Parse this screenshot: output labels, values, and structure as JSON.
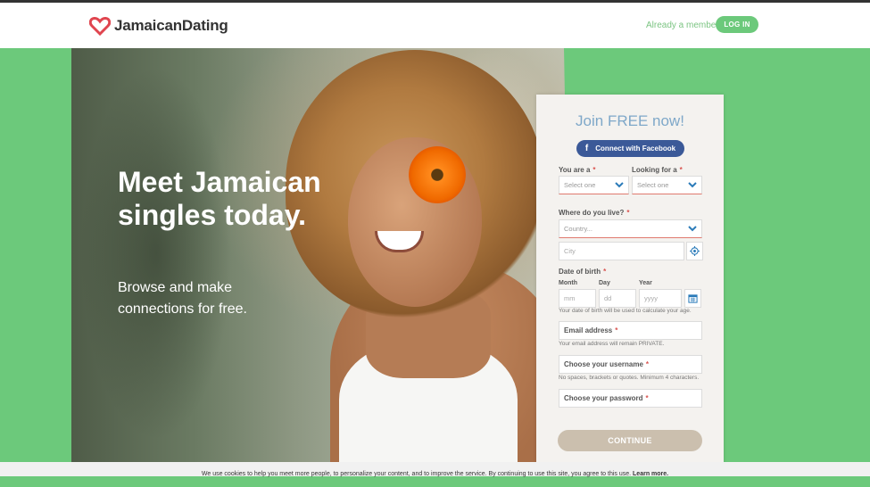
{
  "header": {
    "brand": "JamaicanDating",
    "member_prompt": "Already a member?",
    "login_label": "LOG IN"
  },
  "hero": {
    "headline": "Meet Jamaican singles today.",
    "subtext": "Browse and make connections for free."
  },
  "form": {
    "title": "Join FREE now!",
    "facebook_label": "Connect with Facebook",
    "you_are_label": "You are a",
    "you_are_placeholder": "Select one",
    "looking_for_label": "Looking for a",
    "looking_for_placeholder": "Select one",
    "location_label": "Where do you live?",
    "country_placeholder": "Country...",
    "city_placeholder": "City",
    "dob_label": "Date of birth",
    "month_label": "Month",
    "day_label": "Day",
    "year_label": "Year",
    "month_placeholder": "mm",
    "day_placeholder": "dd",
    "year_placeholder": "yyyy",
    "dob_hint": "Your date of birth will be used to calculate your age.",
    "email_label": "Email address",
    "email_hint": "Your email address will remain PRIVATE.",
    "username_label": "Choose your username",
    "username_hint": "No spaces, brackets or quotes. Minimum 4 characters.",
    "password_label": "Choose your password",
    "required_mark": "*",
    "continue_label": "CONTINUE"
  },
  "cookie": {
    "text": "We use cookies to help you meet more people, to personalize your content, and to improve the service. By continuing to use this site, you agree to this use.",
    "link": "Learn more."
  },
  "colors": {
    "accent_green": "#6cc97b",
    "facebook_blue": "#3b5998",
    "title_blue": "#7fa8c9",
    "required_red": "#d9534f"
  }
}
